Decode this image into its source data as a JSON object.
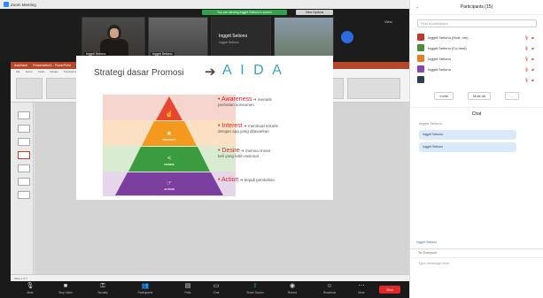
{
  "window": {
    "title": "Zoom Meeting",
    "controls": [
      "–",
      "□",
      "✕"
    ]
  },
  "share": {
    "banner": "You are viewing Inggrit Setiono's screen",
    "view_options": "View Options",
    "view_button": "View"
  },
  "tiles": [
    {
      "name": "Inggrit Setiono"
    },
    {
      "name": "Inggrit Setiono"
    },
    {
      "name": "Inggrit Setiono",
      "big": "Inggrit Setiono",
      "sub": "Inggrit Setiono"
    },
    {
      "name": ""
    }
  ],
  "ppt": {
    "titlebar": [
      "AutoSave",
      "Presentation1 - PowerPoint",
      "Search"
    ],
    "tabs": [
      "File",
      "Home",
      "Insert",
      "Design",
      "Transitions",
      "Animations",
      "Slide Show",
      "Review",
      "View",
      "Help"
    ],
    "status": "Slide 4 of 7"
  },
  "slide": {
    "title": "Strategi dasar Promosi",
    "arrow": "➔",
    "aida": "A I D A",
    "levels": [
      {
        "label": "ATTENTION",
        "icon": "☝",
        "color": "#e8462f"
      },
      {
        "label": "INTEREST",
        "icon": "★",
        "color": "#f39a1e"
      },
      {
        "label": "DESIRE",
        "icon": "<",
        "color": "#3a9b3f"
      },
      {
        "label": "ACTION",
        "icon": "☞",
        "color": "#7b3fa0"
      }
    ],
    "points": [
      {
        "head": "• Awareness",
        "tail": " ➔ menarik",
        "desc": "perhatian konsumen"
      },
      {
        "head": "• Interest",
        "tail": " ➔ membuat tertarik",
        "desc": "dengan apa yang ditawarkan"
      },
      {
        "head": "• Desire",
        "tail": " ➔ memicu minat",
        "desc": "beli yang lebih rasional"
      },
      {
        "head": "• Action",
        "tail": " ➔ terjadi pembelian",
        "desc": ""
      }
    ]
  },
  "panel": {
    "title": "Participants (15)",
    "search_placeholder": "Find a participant",
    "participants": [
      {
        "name": "Inggrit Setiono (Host, me)",
        "color": "#c0392b"
      },
      {
        "name": "Inggrit Setiono (Co-host)",
        "color": "#4d8c3a"
      },
      {
        "name": "Inggrit Setiono",
        "color": "#e67e22"
      },
      {
        "name": "Inggrit Setiono",
        "color": "#8e44ad"
      },
      {
        "name": "",
        "color": "#2c3e50"
      }
    ],
    "buttons": [
      "Invite",
      "Mute All",
      "..."
    ],
    "chat_title": "Chat",
    "chat_from": "Inggrit Setiono",
    "messages": [
      "Inggrit Setiono",
      "Inggrit Setiono"
    ],
    "chat_sent": "Inggrit Setiono",
    "chat_to": "To: Everyone",
    "chat_placeholder": "Type message here..."
  },
  "toolbar": {
    "items": [
      {
        "label": "Mute",
        "icon": "🎙",
        "green": false
      },
      {
        "label": "Stop Video",
        "icon": "■",
        "green": false
      },
      {
        "label": "Security",
        "icon": "⚿",
        "green": false
      },
      {
        "label": "Participants",
        "icon": "👥",
        "green": false
      },
      {
        "label": "Polls",
        "icon": "▤",
        "green": false
      },
      {
        "label": "Chat",
        "icon": "▭",
        "green": false
      },
      {
        "label": "Share Screen",
        "icon": "⇧",
        "green": true
      },
      {
        "label": "Record",
        "icon": "◉",
        "green": false
      },
      {
        "label": "Reactions",
        "icon": "☺",
        "green": false
      },
      {
        "label": "More",
        "icon": "⋯",
        "green": false
      }
    ],
    "end": "End"
  }
}
